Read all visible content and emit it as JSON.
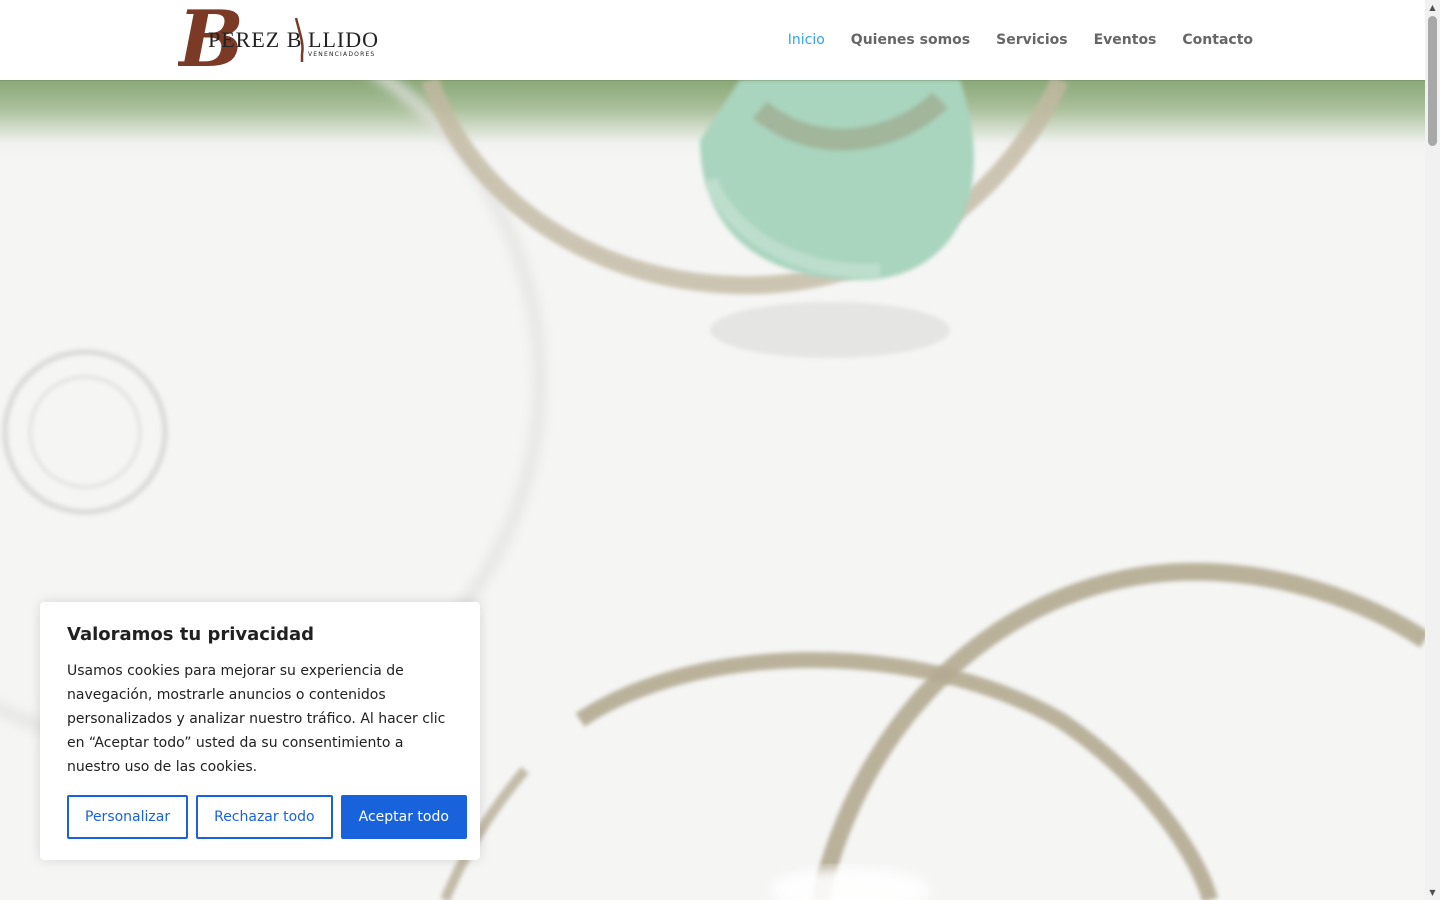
{
  "logo": {
    "initial": "B",
    "name_part1": "PEREZ B",
    "name_part2": "LLIDO",
    "tagline": "VENENCIADORES"
  },
  "nav": {
    "items": [
      {
        "label": "Inicio",
        "active": true
      },
      {
        "label": "Quienes somos",
        "active": false
      },
      {
        "label": "Servicios",
        "active": false
      },
      {
        "label": "Eventos",
        "active": false
      },
      {
        "label": "Contacto",
        "active": false
      }
    ]
  },
  "cookie_banner": {
    "title": "Valoramos tu privacidad",
    "text": "Usamos cookies para mejorar su experiencia de navegación, mostrarle anuncios o contenidos personalizados y analizar nuestro tráfico. Al hacer clic en “Aceptar todo” usted da su consentimiento a nuestro uso de las cookies.",
    "customize_label": "Personalizar",
    "reject_label": "Rechazar todo",
    "accept_label": "Aceptar todo"
  },
  "colors": {
    "accent": "#2ea3f2",
    "cookie_button": "#1863dc",
    "logo_brown": "#7a3a26",
    "ring": "#b4aa92"
  }
}
